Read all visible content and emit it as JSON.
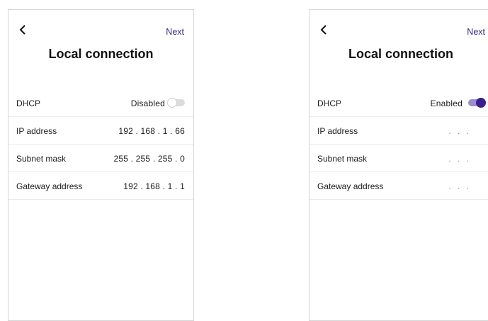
{
  "screens": [
    {
      "next_label": "Next",
      "title": "Local connection",
      "dhcp": {
        "label": "DHCP",
        "status": "Disabled",
        "enabled": false
      },
      "ip": {
        "label": "IP address",
        "value": "192 . 168 . 1 . 66"
      },
      "subnet": {
        "label": "Subnet mask",
        "value": "255 . 255 . 255 . 0"
      },
      "gateway": {
        "label": "Gateway address",
        "value": "192 . 168 . 1 . 1"
      }
    },
    {
      "next_label": "Next",
      "title": "Local connection",
      "dhcp": {
        "label": "DHCP",
        "status": "Enabled",
        "enabled": true
      },
      "ip": {
        "label": "IP address",
        "value": ". . ."
      },
      "subnet": {
        "label": "Subnet mask",
        "value": ". . ."
      },
      "gateway": {
        "label": "Gateway address",
        "value": ". . ."
      }
    }
  ],
  "colors": {
    "accent": "#3a1e8e",
    "accent_track": "#9b8cd6",
    "next_text": "#3b2a86"
  },
  "icons": {
    "back": "back-chevron-icon"
  }
}
